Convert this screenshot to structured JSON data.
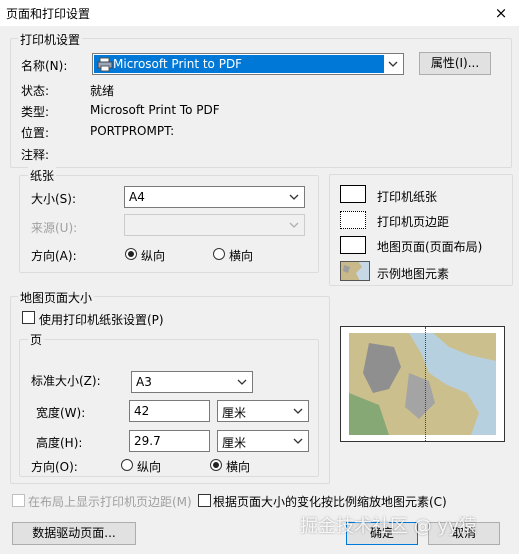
{
  "window": {
    "title": "页面和打印设置",
    "close_glyph": "×"
  },
  "printer": {
    "group_label": "打印机设置",
    "name_label": "名称(N):",
    "name_value": "Microsoft Print to PDF",
    "properties_button": "属性(I)...",
    "status_label": "状态:",
    "status_value": "就绪",
    "type_label": "类型:",
    "type_value": "Microsoft Print To PDF",
    "location_label": "位置:",
    "location_value": "PORTPROMPT:",
    "comment_label": "注释:"
  },
  "paper": {
    "group_label": "纸张",
    "size_label": "大小(S):",
    "size_value": "A4",
    "source_label": "来源(U):",
    "source_value": "",
    "orientation_label": "方向(A):",
    "portrait_label": "纵向",
    "landscape_label": "横向",
    "selected": "portrait"
  },
  "legend": {
    "items": [
      {
        "label": "打印机纸张"
      },
      {
        "label": "打印机页边距"
      },
      {
        "label": "地图页面(页面布局)"
      },
      {
        "label": "示例地图元素"
      }
    ]
  },
  "map_page": {
    "group_label": "地图页面大小",
    "use_printer_label": "使用打印机纸张设置(P)",
    "use_printer_checked": false,
    "page_group_label": "页",
    "standard_size_label": "标准大小(Z):",
    "standard_size_value": "A3",
    "width_label": "宽度(W):",
    "width_value": "42",
    "width_unit": "厘米",
    "height_label": "高度(H):",
    "height_value": "29.7",
    "height_unit": "厘米",
    "orientation_label": "方向(O):",
    "portrait_label": "纵向",
    "landscape_label": "横向",
    "selected": "landscape"
  },
  "options": {
    "show_margins_label": "在布局上显示打印机页边距(M)",
    "scale_elements_label": "根据页面大小的变化按比例缩放地图元素(C)"
  },
  "buttons": {
    "data_driven": "数据驱动页面...",
    "ok": "确定",
    "cancel": "取消"
  },
  "watermark": "掘金技术社区 @ yy猿"
}
